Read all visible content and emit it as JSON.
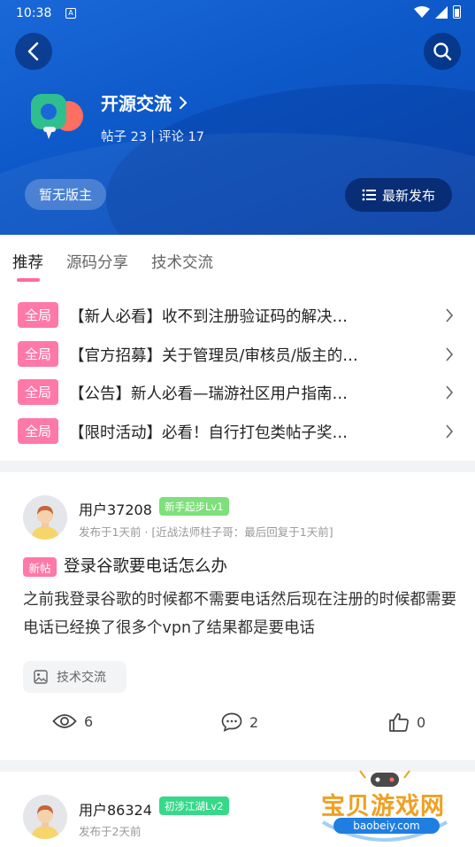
{
  "status_bar": {
    "time": "10:38",
    "notification_icon": "A"
  },
  "header": {
    "back_icon": "chevron-left-icon",
    "search_icon": "search-icon",
    "forum_name": "开源交流",
    "posts_label": "帖子 23",
    "separator": "|",
    "comments_label": "评论 17",
    "moderator_label": "暂无版主",
    "sort_label": "最新发布"
  },
  "tabs": [
    {
      "label": "推荐",
      "active": true
    },
    {
      "label": "源码分享",
      "active": false
    },
    {
      "label": "技术交流",
      "active": false
    }
  ],
  "pinned": [
    {
      "badge": "全局",
      "title": "【新人必看】收不到注册验证码的解决…"
    },
    {
      "badge": "全局",
      "title": "【官方招募】关于管理员/审核员/版主的…"
    },
    {
      "badge": "全局",
      "title": "【公告】新人必看—瑞游社区用户指南…"
    },
    {
      "badge": "全局",
      "title": "【限时活动】必看！自行打包类帖子奖…"
    }
  ],
  "posts": [
    {
      "username": "用户37208",
      "level": "新手起步Lv1",
      "level_color": "#7ee07a",
      "meta": "发布于1天前 · [近战法师柱子哥：最后回复于1天前]",
      "new_badge": "新帖",
      "title": "登录谷歌要电话怎么办",
      "body": "之前我登录谷歌的时候都不需要电话然后现在注册的时候都需要电话已经换了很多个vpn了结果都是要电话",
      "category": "技术交流",
      "views": "6",
      "comments": "2",
      "likes": "0"
    },
    {
      "username": "用户86324",
      "level": "初涉江湖Lv2",
      "level_color": "#36d98a",
      "meta": "发布于2天前"
    }
  ],
  "watermark": {
    "title": "宝贝游戏网",
    "url": "baobeiy.com"
  },
  "colors": {
    "header_blue": "#0d58c8",
    "accent_pink": "#ff79a8"
  }
}
